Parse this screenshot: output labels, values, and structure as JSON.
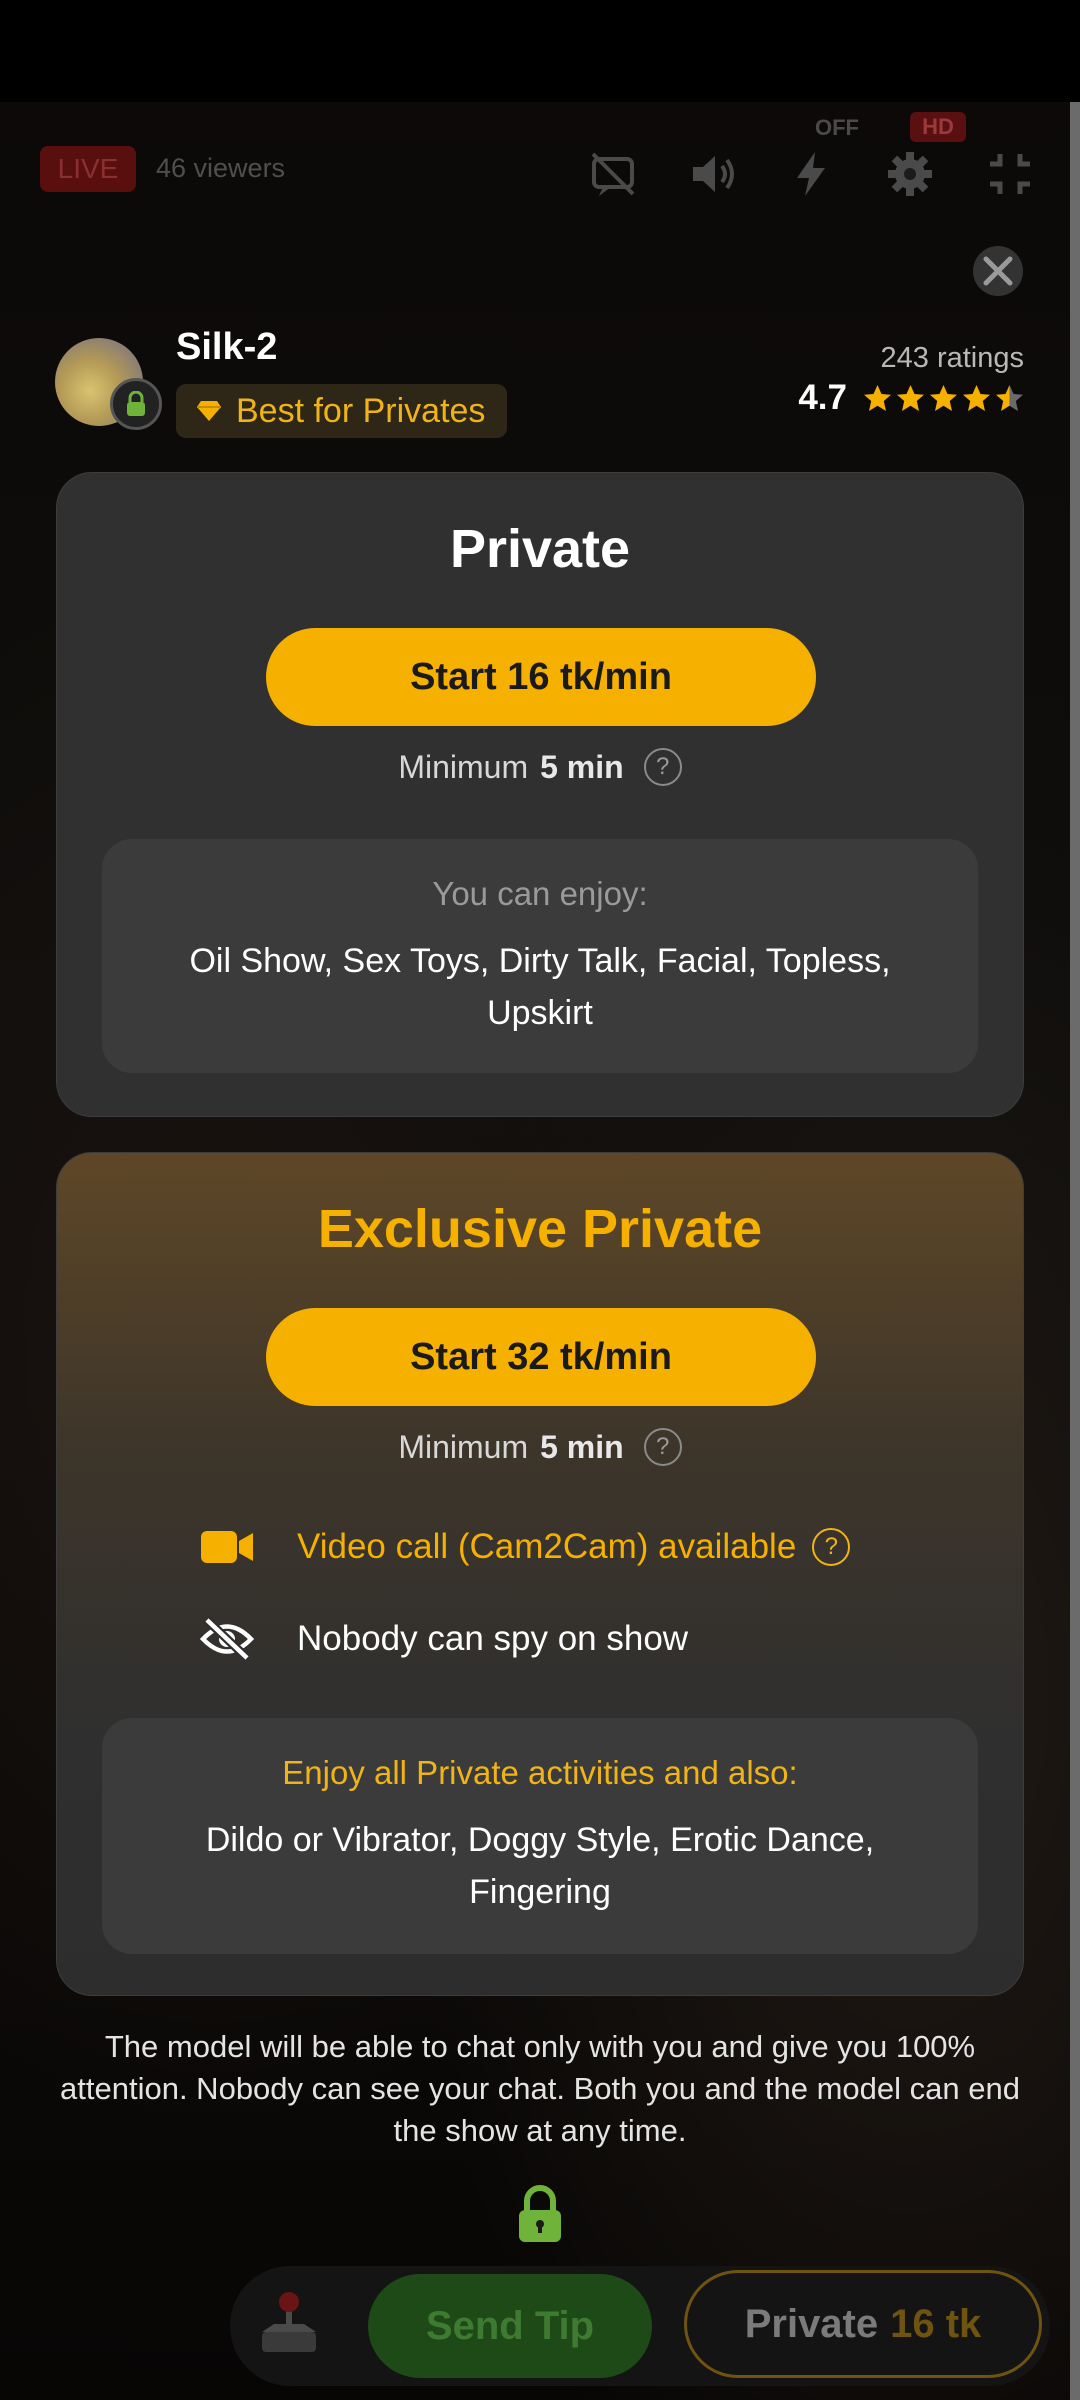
{
  "stream": {
    "live_label": "LIVE",
    "viewers": "46 viewers",
    "lightning_status": "OFF",
    "quality_badge": "HD"
  },
  "model": {
    "name": "Silk-2",
    "badge": "Best for Privates",
    "ratings_count": "243 ratings",
    "rating": "4.7",
    "stars": 4.5
  },
  "private": {
    "title": "Private",
    "start_label": "Start 16 tk/min",
    "minimum_prefix": "Minimum",
    "minimum_value": "5 min",
    "enjoy_header": "You can enjoy:",
    "activities": "Oil Show, Sex Toys, Dirty Talk, Facial, Topless, Upskirt"
  },
  "exclusive": {
    "title": "Exclusive Private",
    "start_label": "Start 32 tk/min",
    "minimum_prefix": "Minimum",
    "minimum_value": "5 min",
    "feature_cam2cam": "Video call (Cam2Cam) available",
    "feature_nospy": "Nobody can spy on show",
    "enjoy_header": "Enjoy all Private activities and also:",
    "activities": "Dildo or Vibrator, Doggy Style, Erotic Dance, Fingering"
  },
  "footer_note": "The model will be able to chat only with you and give you 100% attention. Nobody can see your chat. Both you and the model can end the show at any time.",
  "bottom_bar": {
    "tip_label": "Send Tip",
    "private_label": "Private",
    "private_price": "16 tk"
  },
  "colors": {
    "accent": "#f5b000",
    "lock_green": "#6fb33a"
  }
}
